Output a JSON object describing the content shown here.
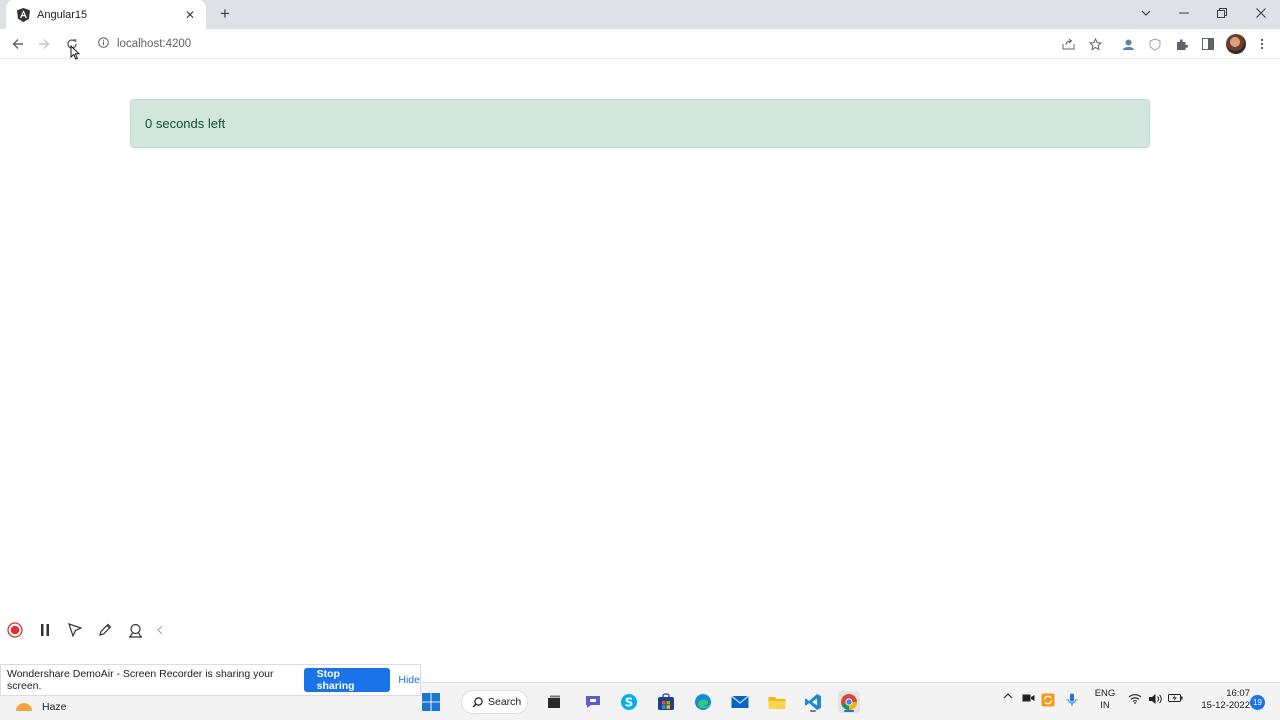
{
  "browser": {
    "tab_title": "Angular15",
    "url": "localhost:4200"
  },
  "page": {
    "alert_text": "0 seconds left",
    "alert_bg": "#d1e7dd",
    "alert_text_color": "#0f5132"
  },
  "recorder": {
    "share_message": "Wondershare DemoAir - Screen Recorder is sharing your screen.",
    "stop_label": "Stop sharing",
    "hide_label": "Hide"
  },
  "taskbar": {
    "weather": "Haze",
    "search_label": "Search",
    "lang_line1": "ENG",
    "lang_line2": "IN",
    "time": "16:07",
    "date": "15-12-2022",
    "notification_count": "19"
  },
  "colors": {
    "accent": "#1a73e8",
    "tabstrip": "#dee1e6"
  }
}
